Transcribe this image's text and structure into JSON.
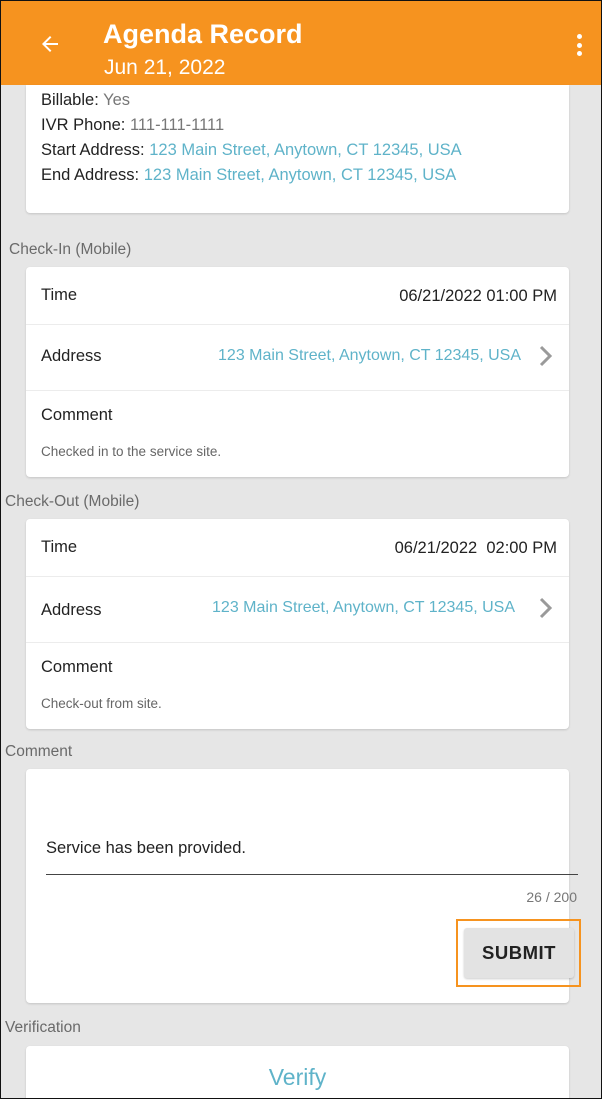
{
  "header": {
    "title": "Agenda Record",
    "subtitle": "Jun 21, 2022",
    "back_icon": "arrow-left-icon",
    "menu_icon": "more-vert-icon",
    "background": "#f6931f"
  },
  "details": {
    "billable_key": "Billable:",
    "billable_value": "Yes",
    "ivr_key": "IVR Phone:",
    "ivr_value": "111-111-1111",
    "start_key": "Start Address:",
    "start_value": "123 Main Street, Anytown, CT 12345, USA",
    "end_key": "End Address:",
    "end_value": "123 Main Street, Anytown, CT 12345, USA"
  },
  "checkin": {
    "header": "Check-In (Mobile)",
    "time_label": "Time",
    "time_value": "06/21/2022 01:00 PM",
    "address_label": "Address",
    "address_value": "123 Main Street, Anytown, CT 12345, USA",
    "comment_label": "Comment",
    "comment_value": "Checked in to the service site."
  },
  "checkout": {
    "header": "Check-Out (Mobile)",
    "time_label": "Time",
    "time_value": "06/21/2022  02:00 PM",
    "address_label": "Address",
    "address_value": "123 Main Street, Anytown, CT 12345, USA",
    "comment_label": "Comment",
    "comment_value": "Check-out from site."
  },
  "comment": {
    "header": "Comment",
    "input_value": "Service has been provided.",
    "counter": "26 / 200",
    "submit_label": "SUBMIT"
  },
  "verification": {
    "header": "Verification",
    "verify_label": "Verify"
  },
  "colors": {
    "accent": "#f6931f",
    "link": "#5fb3c9",
    "background": "#e6e6e6"
  }
}
